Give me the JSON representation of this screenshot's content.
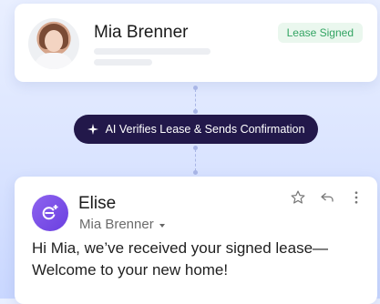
{
  "contact": {
    "name": "Mia Brenner",
    "status": "Lease Signed"
  },
  "step": {
    "label": "AI Verifies Lease & Sends Confirmation",
    "icon": "sparkle-icon"
  },
  "email": {
    "sender": "Elise",
    "recipient": "Mia Brenner",
    "message": "Hi Mia, we’ve received your signed lease—Welcome to your new home!",
    "actions": [
      {
        "icon": "star-icon"
      },
      {
        "icon": "reply-icon"
      },
      {
        "icon": "more-icon"
      }
    ]
  },
  "colors": {
    "status": "#33a463",
    "pill": "#22184a",
    "brand": "#7a4ae6"
  }
}
